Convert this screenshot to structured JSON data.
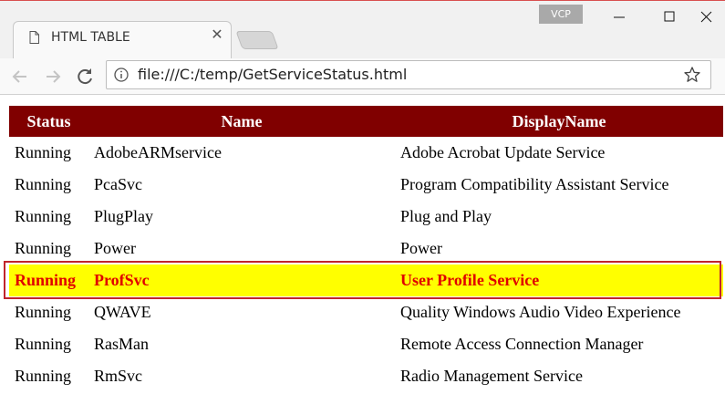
{
  "browser": {
    "tab_title": "HTML TABLE",
    "profile_label": "VCP",
    "url": "file:///C:/temp/GetServiceStatus.html"
  },
  "table": {
    "headers": [
      "Status",
      "Name",
      "DisplayName"
    ],
    "rows": [
      {
        "status": "Running",
        "name": "AdobeARMservice",
        "display": "Adobe Acrobat Update Service"
      },
      {
        "status": "Running",
        "name": "PcaSvc",
        "display": "Program Compatibility Assistant Service"
      },
      {
        "status": "Running",
        "name": "PlugPlay",
        "display": "Plug and Play"
      },
      {
        "status": "Running",
        "name": "Power",
        "display": "Power"
      },
      {
        "status": "Running",
        "name": "ProfSvc",
        "display": "User Profile Service"
      },
      {
        "status": "Running",
        "name": "QWAVE",
        "display": "Quality Windows Audio Video Experience"
      },
      {
        "status": "Running",
        "name": "RasMan",
        "display": "Remote Access Connection Manager"
      },
      {
        "status": "Running",
        "name": "RmSvc",
        "display": "Radio Management Service"
      }
    ]
  },
  "colors": {
    "header_bg": "#800000",
    "highlight_bg": "#ffff00",
    "highlight_text": "#e00000"
  }
}
